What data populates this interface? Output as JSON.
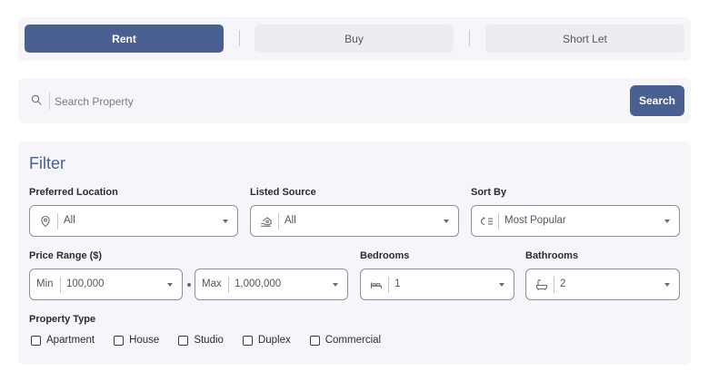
{
  "tabs": [
    {
      "label": "Rent",
      "active": true
    },
    {
      "label": "Buy",
      "active": false
    },
    {
      "label": "Short Let",
      "active": false
    }
  ],
  "search": {
    "placeholder": "Search Property",
    "value": "",
    "button_label": "Search",
    "icon": "search-icon"
  },
  "filter": {
    "title": "Filter",
    "preferred_location": {
      "label": "Preferred Location",
      "value": "All",
      "icon": "location-pin-icon"
    },
    "listed_source": {
      "label": "Listed Source",
      "value": "All",
      "icon": "house-hand-icon"
    },
    "sort_by": {
      "label": "Sort By",
      "value": "Most Popular",
      "icon": "sort-icon"
    },
    "price_range": {
      "label": "Price Range ($)",
      "min": {
        "prefix": "Min",
        "value": "100,000"
      },
      "max": {
        "prefix": "Max",
        "value": "1,000,000"
      }
    },
    "bedrooms": {
      "label": "Bedrooms",
      "value": "1",
      "icon": "bed-icon"
    },
    "bathrooms": {
      "label": "Bathrooms",
      "value": "2",
      "icon": "bathtub-icon"
    },
    "property_type": {
      "label": "Property Type",
      "options": [
        {
          "label": "Apartment",
          "checked": false
        },
        {
          "label": "House",
          "checked": false
        },
        {
          "label": "Studio",
          "checked": false
        },
        {
          "label": "Duplex",
          "checked": false
        },
        {
          "label": "Commercial",
          "checked": false
        }
      ]
    }
  },
  "colors": {
    "accent": "#4a5f92",
    "panel": "#f6f6fa",
    "inactive_tab": "#ececf1"
  }
}
